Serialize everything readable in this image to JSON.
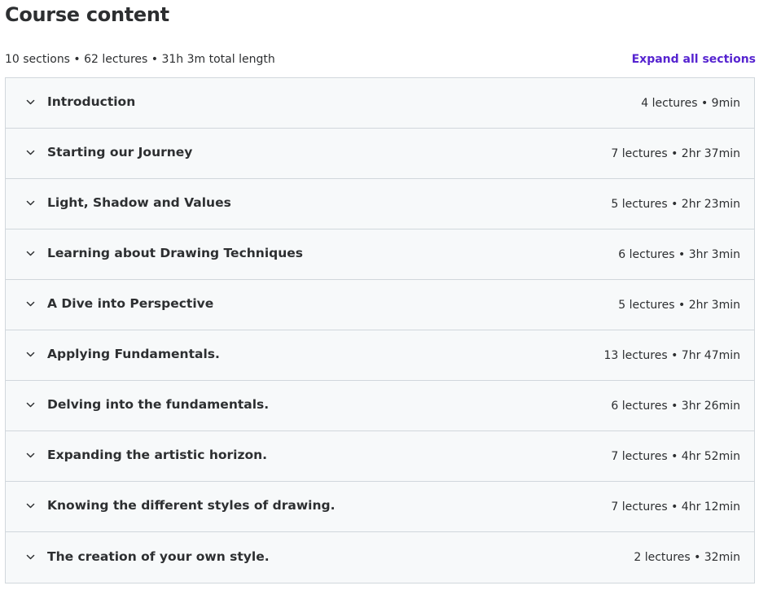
{
  "header": {
    "title": "Course content",
    "summary": "10 sections • 62 lectures • 31h 3m total length",
    "expand_all_label": "Expand all sections"
  },
  "colors": {
    "accent": "#5624d0",
    "text": "#2d2f31",
    "row_background": "#f7f9fa",
    "border": "#d1d7dc"
  },
  "sections": [
    {
      "title": "Introduction",
      "meta": "4 lectures • 9min",
      "icon": "chevron-down-icon"
    },
    {
      "title": "Starting our Journey",
      "meta": "7 lectures • 2hr 37min",
      "icon": "chevron-down-icon"
    },
    {
      "title": "Light, Shadow and Values",
      "meta": "5 lectures • 2hr 23min",
      "icon": "chevron-down-icon"
    },
    {
      "title": "Learning about Drawing Techniques",
      "meta": "6 lectures • 3hr 3min",
      "icon": "chevron-down-icon"
    },
    {
      "title": "A Dive into Perspective",
      "meta": "5 lectures • 2hr 3min",
      "icon": "chevron-down-icon"
    },
    {
      "title": "Applying Fundamentals.",
      "meta": "13 lectures • 7hr 47min",
      "icon": "chevron-down-icon"
    },
    {
      "title": "Delving into the fundamentals.",
      "meta": "6 lectures • 3hr 26min",
      "icon": "chevron-down-icon"
    },
    {
      "title": "Expanding the artistic horizon.",
      "meta": "7 lectures • 4hr 52min",
      "icon": "chevron-down-icon"
    },
    {
      "title": "Knowing the different styles of drawing.",
      "meta": "7 lectures • 4hr 12min",
      "icon": "chevron-down-icon"
    },
    {
      "title": "The creation of your own style.",
      "meta": "2 lectures • 32min",
      "icon": "chevron-down-icon"
    }
  ]
}
